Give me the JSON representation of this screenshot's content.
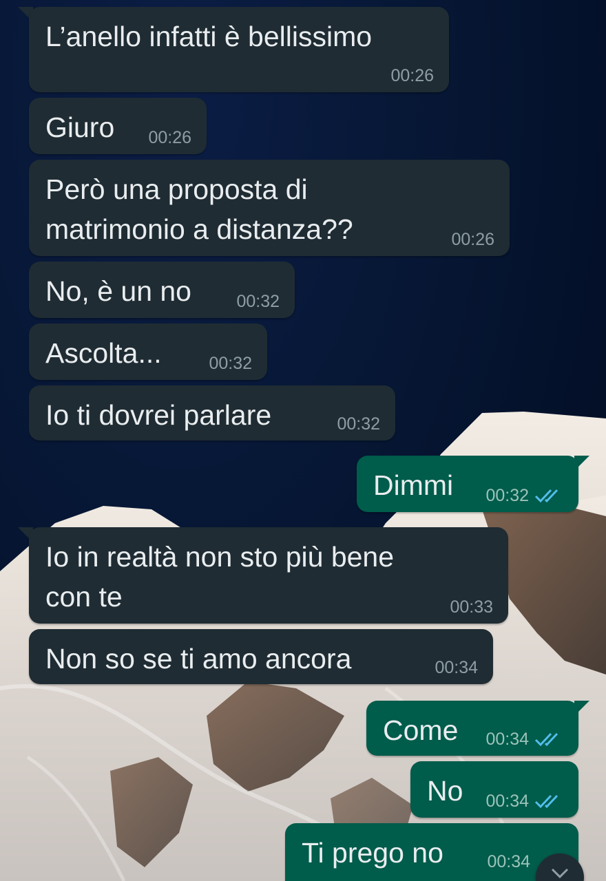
{
  "messages": [
    {
      "direction": "in",
      "text": "L’anello infatti è bellissimo",
      "time": "00:26"
    },
    {
      "direction": "in",
      "text": "Giuro",
      "time": "00:26"
    },
    {
      "direction": "in",
      "text": "Però una proposta di\nmatrimonio a distanza??",
      "time": "00:26"
    },
    {
      "direction": "in",
      "text": "No, è un no",
      "time": "00:32"
    },
    {
      "direction": "in",
      "text": "Ascolta...",
      "time": "00:32"
    },
    {
      "direction": "in",
      "text": "Io ti dovrei parlare",
      "time": "00:32"
    },
    {
      "direction": "out",
      "text": "Dimmi",
      "time": "00:32",
      "status": "read"
    },
    {
      "direction": "in",
      "text": "Io in realtà non sto più bene\ncon te",
      "time": "00:33"
    },
    {
      "direction": "in",
      "text": "Non so se ti amo ancora",
      "time": "00:34"
    },
    {
      "direction": "out",
      "text": "Come",
      "time": "00:34",
      "status": "read"
    },
    {
      "direction": "out",
      "text": "No",
      "time": "00:34",
      "status": "read"
    },
    {
      "direction": "out",
      "text": "Ti prego no",
      "time": "00:34"
    }
  ],
  "colors": {
    "incoming_bubble": "#1f2c33",
    "outgoing_bubble": "#005c4b",
    "read_ticks": "#53bdeb",
    "timestamp": "#8f9ea6"
  },
  "icons": {
    "read_receipt": "double-check-icon",
    "scroll_down": "chevron-down-icon"
  }
}
